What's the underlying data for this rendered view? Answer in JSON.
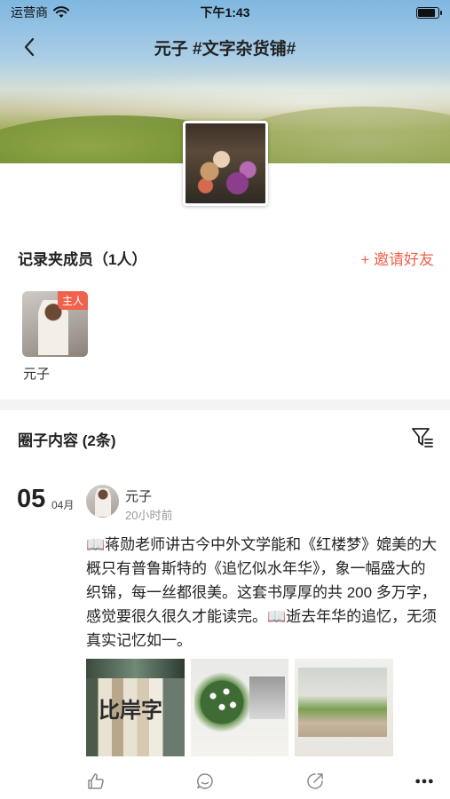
{
  "status_bar": {
    "carrier": "运营商",
    "time": "下午1:43",
    "battery_level": 0.9
  },
  "nav": {
    "title": "元子 #文字杂货铺#",
    "back_icon": "chevron-left-icon"
  },
  "members": {
    "title": "记录夹成员（1人）",
    "invite_label": "+ 邀请好友",
    "list": [
      {
        "name": "元子",
        "tag": "主人"
      }
    ]
  },
  "circle": {
    "title": "圈子内容 (2条)",
    "filter_icon": "filter-icon"
  },
  "post": {
    "day": "05",
    "month": "04月",
    "author": "元子",
    "time_ago": "20小时前",
    "text": "📖蒋勋老师讲古今中外文学能和《红楼梦》媲美的大概只有普鲁斯特的《追忆似水年华》，象一幅盛大的织锦，每一丝都很美。这套书厚厚的共 200 多万字，感觉要很久很久才能读完。📖逝去年华的追忆，无须真实记忆如一。",
    "photo1_text": "比岸字"
  },
  "accent_color": "#f0624b"
}
